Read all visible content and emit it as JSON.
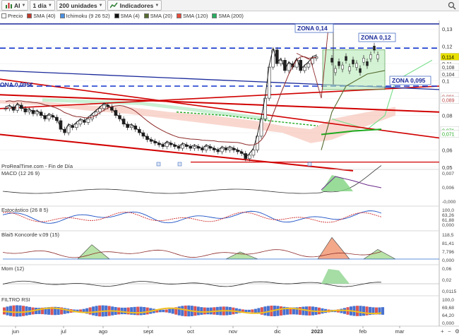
{
  "toolbar": {
    "symbol": "AI",
    "interval": "1 día",
    "units": "200 unidades",
    "indicators": "Indicadores"
  },
  "legend": [
    {
      "label": "Precio",
      "color": "#ffffff"
    },
    {
      "label": "SMA (40)",
      "color": "#c0392b"
    },
    {
      "label": "Ichimoku (9 26 52)",
      "color": "#4a90e2"
    },
    {
      "label": "SMA (4)",
      "color": "#111111"
    },
    {
      "label": "SMA (20)",
      "color": "#556b2f"
    },
    {
      "label": "SMA (120)",
      "color": "#e74c3c"
    },
    {
      "label": "SMA (200)",
      "color": "#27ae60"
    }
  ],
  "source_label": "ProRealTime.com - Fin de Día",
  "chart_data": {
    "type": "line",
    "x_ticks": [
      "jun",
      "jul",
      "ago",
      "sept",
      "oct",
      "nov",
      "dic",
      "2023",
      "feb",
      "mar"
    ],
    "y_ticks": [
      "0,13",
      "0,12",
      "0,11",
      "0,1",
      "0,09",
      "0,08",
      "0,07",
      "0,06",
      "0,05"
    ],
    "ylim": [
      0.05,
      0.135
    ],
    "price_last": "0,114",
    "right_labels": [
      {
        "text": "0,114",
        "value": 0.114,
        "color": "#e8e000",
        "fg": "#000"
      },
      {
        "text": "0,108",
        "value": 0.108,
        "color": "#ffffff",
        "fg": "#333"
      },
      {
        "text": "0,104",
        "value": 0.104,
        "color": "#ffffff",
        "fg": "#333"
      },
      {
        "text": "0,091",
        "value": 0.091,
        "color": "#ffffff",
        "fg": "#b44"
      },
      {
        "text": "0,089",
        "value": 0.089,
        "color": "#ffffff",
        "fg": "#b44"
      },
      {
        "text": "0,071",
        "value": 0.0715,
        "color": "#ffffff",
        "fg": "#2a2"
      },
      {
        "text": "0,071",
        "value": 0.0695,
        "color": "#ffffff",
        "fg": "#2a2"
      }
    ],
    "annotations": [
      {
        "text": "ZONA 0,14"
      },
      {
        "text": "ZONA 0,12"
      },
      {
        "text": "ZONA 0,095"
      },
      {
        "text": "ONA 0,095€"
      }
    ],
    "price_series": [
      0.084,
      0.085,
      0.083,
      0.086,
      0.084,
      0.082,
      0.083,
      0.081,
      0.082,
      0.08,
      0.078,
      0.08,
      0.079,
      0.077,
      0.072,
      0.07,
      0.074,
      0.073,
      0.075,
      0.077,
      0.076,
      0.078,
      0.08,
      0.082,
      0.084,
      0.086,
      0.085,
      0.083,
      0.08,
      0.078,
      0.075,
      0.073,
      0.074,
      0.072,
      0.07,
      0.068,
      0.066,
      0.065,
      0.064,
      0.063,
      0.062,
      0.064,
      0.063,
      0.062,
      0.061,
      0.063,
      0.062,
      0.061,
      0.062,
      0.061,
      0.06,
      0.062,
      0.061,
      0.06,
      0.059,
      0.061,
      0.06,
      0.061,
      0.06,
      0.059,
      0.058,
      0.055,
      0.057,
      0.06,
      0.068,
      0.078,
      0.09,
      0.108,
      0.118,
      0.11,
      0.112,
      0.106,
      0.11,
      0.108,
      0.112,
      0.106,
      0.108,
      0.11,
      0.113,
      0.114
    ],
    "panels": [
      {
        "name": "MACD (12 26 9)",
        "labels": [
          "0,007",
          "0,006",
          "-0,000"
        ]
      },
      {
        "name": "Estocástico (26 8 5)",
        "labels": [
          "100,0",
          "63,26",
          "61,88",
          "0,000"
        ]
      },
      {
        "name": "Blai5 Koncorde v.09 (15)",
        "labels": [
          "118,5",
          "81,41",
          "7,796",
          "0,000"
        ]
      },
      {
        "name": "Mom (12)",
        "labels": [
          "0,06",
          "0,02",
          "0,0115"
        ]
      },
      {
        "name": "FILTRO RSI",
        "labels": [
          "100,0",
          "69,68",
          "64,20",
          "0,000"
        ]
      }
    ]
  }
}
